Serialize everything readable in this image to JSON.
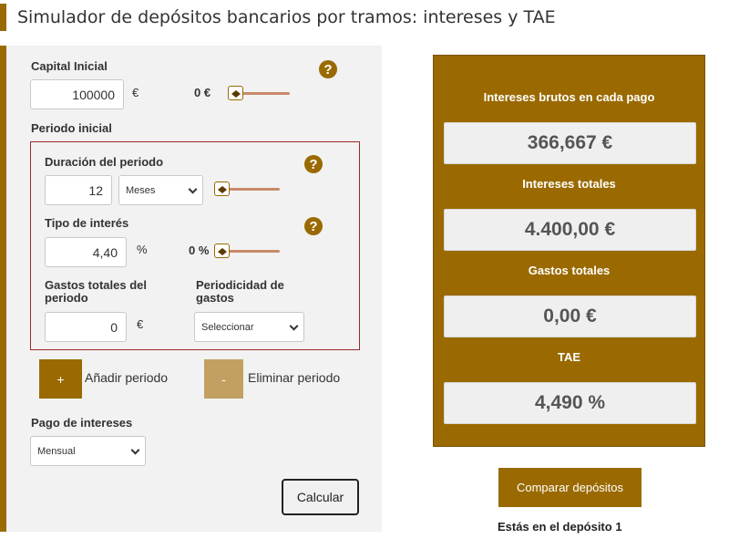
{
  "title": "Simulador de depósitos bancarios por tramos: intereses y TAE",
  "capital": {
    "label": "Capital Inicial",
    "value": "100000",
    "unit": "€",
    "min_label": "0 €",
    "help": "?",
    "slider_level": 0
  },
  "periodo_inicial": {
    "label": "Periodo inicial",
    "duracion": {
      "label": "Duración del periodo",
      "value": "12",
      "unit_select": "Meses",
      "help": "?",
      "slider_level": 0
    },
    "interes": {
      "label": "Tipo de interés",
      "value": "4,40",
      "unit": "%",
      "min_label": "0 %",
      "help": "?",
      "slider_level": 0
    },
    "gastos": {
      "label": "Gastos totales del periodo",
      "value": "0",
      "unit": "€",
      "periodicidad_label": "Periodicidad de gastos",
      "periodicidad_value": "Seleccionar"
    }
  },
  "buttons": {
    "add_symbol": "+",
    "add_label": "Añadir periodo",
    "delete_symbol": "-",
    "delete_label": "Eliminar periodo",
    "calc_label": "Calcular",
    "compare_label": "Comparar depósitos"
  },
  "pago_intereses": {
    "label": "Pago de intereses",
    "value": "Mensual"
  },
  "results": {
    "intereses_pago_label": "Intereses brutos en cada pago",
    "intereses_pago_value": "366,667 €",
    "intereses_totales_label": "Intereses totales",
    "intereses_totales_value": "4.400,00 €",
    "gastos_label": "Gastos totales",
    "gastos_value": "0,00 €",
    "tae_label": "TAE",
    "tae_value": "4,490 %"
  },
  "deposit_note": "Estás en el depósito 1",
  "colors": {
    "accent": "#9a6a00",
    "accent_light": "#c1a062",
    "panel_bg": "#f2f2f2",
    "period_border": "#9a2a2a"
  },
  "icons": {
    "help": "question-circle-icon",
    "slider": "slider-thumb-arrows-icon",
    "dropdown": "chevron-down-icon"
  }
}
